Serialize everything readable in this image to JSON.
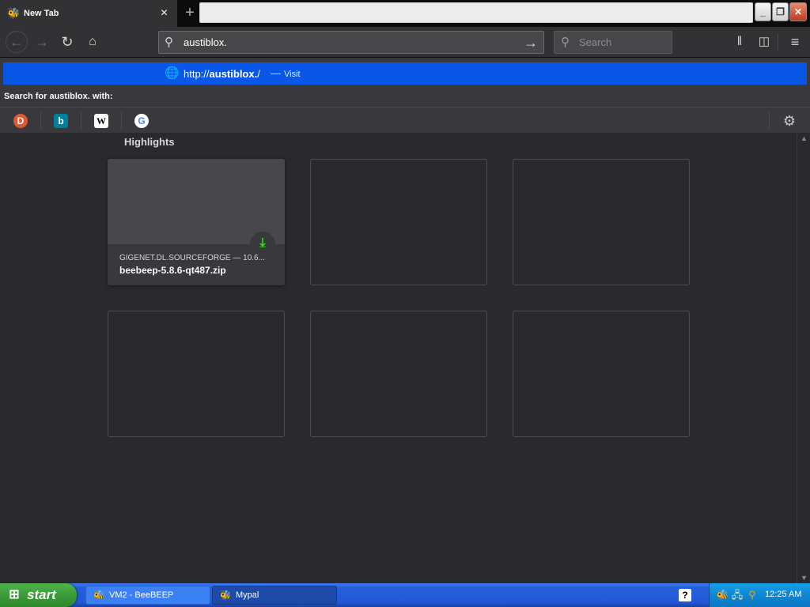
{
  "tab": {
    "title": "New Tab"
  },
  "window_controls": {
    "minimize": "_",
    "restore": "❐",
    "close": "✕"
  },
  "urlbar": {
    "value": "austiblox."
  },
  "searchbar": {
    "placeholder": "Search"
  },
  "autocomplete": {
    "row": {
      "url_prefix": "http://",
      "url_bold": "austiblox.",
      "url_suffix": "/",
      "separator": "—",
      "action": "Visit"
    },
    "search_with_label": "Search for austiblox. with:",
    "engines": [
      {
        "name": "DuckDuckGo",
        "glyph": "D"
      },
      {
        "name": "Bing",
        "glyph": "b"
      },
      {
        "name": "Wikipedia",
        "glyph": "W"
      },
      {
        "name": "Google",
        "glyph": "G"
      }
    ]
  },
  "highlights": {
    "title": "Highlights",
    "cards": [
      {
        "host": "GIGENET.DL.SOURCEFORGE — 10.6...",
        "title": "beebeep-5.8.6-qt487.zip",
        "badge": "download-icon"
      }
    ]
  },
  "taskbar": {
    "start_label": "start",
    "tasks": [
      {
        "label": "VM2 - BeeBEEP"
      },
      {
        "label": "Mypal"
      }
    ],
    "help_glyph": "?",
    "clock": "12:25 AM"
  },
  "colors": {
    "popup_highlight": "#0a56e6",
    "toolbar": "#323234",
    "content_bg": "#2a2a2e",
    "download_green": "#30e60b"
  }
}
